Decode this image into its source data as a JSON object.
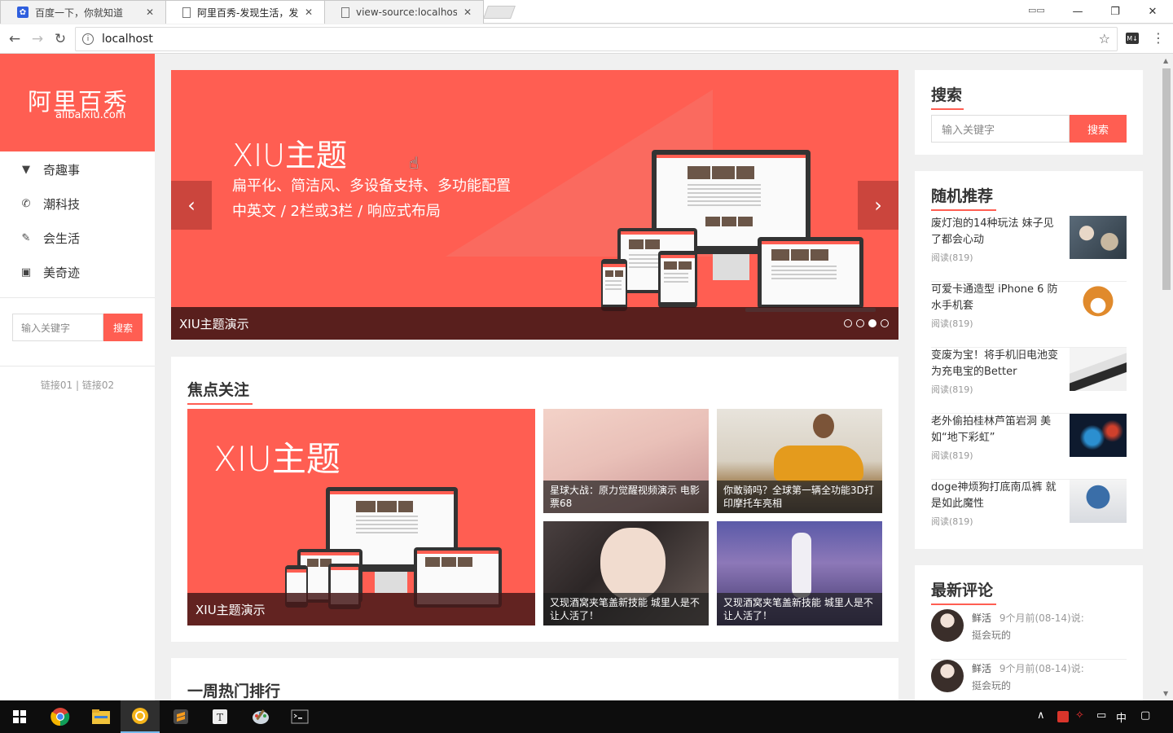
{
  "browser": {
    "tabs": [
      {
        "title": "百度一下，你就知道",
        "close": "✕"
      },
      {
        "title": "阿里百秀-发现生活，发现",
        "close": "✕"
      },
      {
        "title": "view-source:localhost",
        "close": "✕"
      }
    ],
    "url": "localhost",
    "window_controls": {
      "minimize": "—",
      "maximize": "❐",
      "close": "✕"
    }
  },
  "site": {
    "logo_cn": "阿里百秀",
    "logo_en": "alibaixiu.com",
    "nav": [
      {
        "label": "奇趣事",
        "icon": "funnel-icon"
      },
      {
        "label": "潮科技",
        "icon": "phone-icon"
      },
      {
        "label": "会生活",
        "icon": "pen-icon"
      },
      {
        "label": "美奇迹",
        "icon": "gift-icon"
      }
    ],
    "side_search": {
      "placeholder": "输入关键字",
      "button": "搜索"
    },
    "links": {
      "link1": "链接01",
      "sep": "|",
      "link2": "链接02"
    }
  },
  "slider": {
    "headline": "XIU主题",
    "line1": "扁平化、简洁风、多设备支持、多功能配置",
    "line2": "中英文 / 2栏或3栏 / 响应式布局",
    "caption": "XIU主题演示",
    "prev": "‹",
    "next": "›",
    "active_dot": 2,
    "dot_count": 4
  },
  "focus": {
    "title": "焦点关注",
    "big": {
      "headline": "XIU主题",
      "caption": "XIU主题演示"
    },
    "tiles": [
      {
        "caption": "星球大战：原力觉醒视频演示 电影票68"
      },
      {
        "caption": "你敢骑吗？全球第一辆全功能3D打印摩托车亮相"
      },
      {
        "caption": "又现酒窝夹笔盖新技能 城里人是不让人活了！"
      },
      {
        "caption": "又现酒窝夹笔盖新技能 城里人是不让人活了！"
      }
    ]
  },
  "weekly": {
    "title": "一周热门排行"
  },
  "right": {
    "search": {
      "title": "搜索",
      "placeholder": "输入关键字",
      "button": "搜索"
    },
    "random": {
      "title": "随机推荐",
      "items": [
        {
          "title": "废灯泡的14种玩法 妹子见了都会心动",
          "reads": "阅读(819)"
        },
        {
          "title": "可爱卡通造型 iPhone 6 防水手机套",
          "reads": "阅读(819)"
        },
        {
          "title": "变废为宝！将手机旧电池变为充电宝的Better",
          "reads": "阅读(819)"
        },
        {
          "title": "老外偷拍桂林芦笛岩洞 美如“地下彩虹”",
          "reads": "阅读(819)"
        },
        {
          "title": "doge神烦狗打底南瓜裤 就是如此魔性",
          "reads": "阅读(819)"
        }
      ]
    },
    "comments": {
      "title": "最新评论",
      "items": [
        {
          "user": "鲜活",
          "time": "9个月前(08-14)说:",
          "text": "挺会玩的"
        },
        {
          "user": "鲜活",
          "time": "9个月前(08-14)说:",
          "text": "挺会玩的"
        }
      ]
    }
  },
  "taskbar": {
    "clock_lang": "中",
    "apps": [
      "start-icon",
      "chrome-icon",
      "explorer-icon",
      "app-icon",
      "sublime-icon",
      "typora-icon",
      "paint-icon",
      "terminal-icon"
    ]
  },
  "colors": {
    "accent": "#ff5e52",
    "text": "#333333",
    "muted": "#999999"
  }
}
